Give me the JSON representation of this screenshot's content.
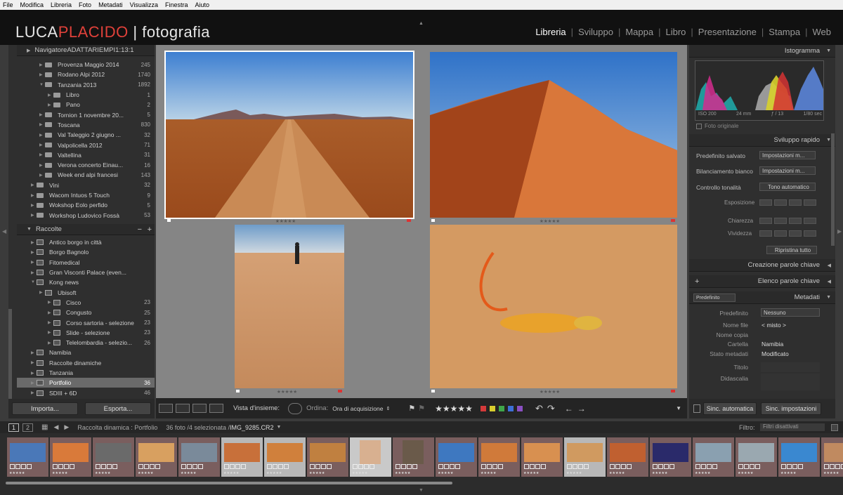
{
  "menu": [
    "File",
    "Modifica",
    "Libreria",
    "Foto",
    "Metadati",
    "Visualizza",
    "Finestra",
    "Aiuto"
  ],
  "logo": {
    "part1": "LUCA",
    "part2": "PLACIDO",
    "part3": " | fotografia"
  },
  "modules": [
    "Libreria",
    "Sviluppo",
    "Mappa",
    "Libro",
    "Presentazione",
    "Stampa",
    "Web"
  ],
  "navigator": {
    "title": "Navigatore",
    "options": [
      "ADATTA",
      "RIEMPI",
      "1:1",
      "3:1"
    ]
  },
  "folders": [
    {
      "name": "Provenza Maggio 2014",
      "count": "245",
      "level": 1
    },
    {
      "name": "Rodano Alpi 2012",
      "count": "1740",
      "level": 1
    },
    {
      "name": "Tanzania 2013",
      "count": "1892",
      "level": 1,
      "open": true
    },
    {
      "name": "Libro",
      "count": "1",
      "level": 2
    },
    {
      "name": "Pano",
      "count": "2",
      "level": 2
    },
    {
      "name": "Tornion 1 novembre 20...",
      "count": "5",
      "level": 1
    },
    {
      "name": "Toscana",
      "count": "830",
      "level": 1
    },
    {
      "name": "Val Taleggio 2 giugno ...",
      "count": "32",
      "level": 1
    },
    {
      "name": "Valpolicella 2012",
      "count": "71",
      "level": 1
    },
    {
      "name": "Valtellina",
      "count": "31",
      "level": 1
    },
    {
      "name": "Verona concerto Einau...",
      "count": "16",
      "level": 1
    },
    {
      "name": "Week end alpi francesi",
      "count": "143",
      "level": 1
    },
    {
      "name": "Vini",
      "count": "32",
      "level": 0
    },
    {
      "name": "Wacom Intuos 5 Touch",
      "count": "9",
      "level": 0
    },
    {
      "name": "Wokshop Eolo perfido",
      "count": "5",
      "level": 0
    },
    {
      "name": "Workshop Ludovico Fossà",
      "count": "53",
      "level": 0
    }
  ],
  "collections": {
    "title": "Raccolte",
    "items": [
      {
        "name": "Antico borgo in città",
        "count": "",
        "level": 0
      },
      {
        "name": "Borgo Bagnolo",
        "count": "",
        "level": 0
      },
      {
        "name": "Fitomedical",
        "count": "",
        "level": 0
      },
      {
        "name": "Gran Visconti Palace (even...",
        "count": "",
        "level": 0
      },
      {
        "name": "Kong news",
        "count": "",
        "level": 0,
        "open": true
      },
      {
        "name": "Ubisoft",
        "count": "",
        "level": 1
      },
      {
        "name": "Cisco",
        "count": "23",
        "level": 2
      },
      {
        "name": "Congusto",
        "count": "25",
        "level": 2
      },
      {
        "name": "Corso sartoria - selezione",
        "count": "23",
        "level": 2
      },
      {
        "name": "Slide - selezione",
        "count": "23",
        "level": 2
      },
      {
        "name": "Telelombardia - selezio...",
        "count": "26",
        "level": 2
      },
      {
        "name": "Namibia",
        "count": "",
        "level": 0
      },
      {
        "name": "Raccolte dinamiche",
        "count": "",
        "level": 0
      },
      {
        "name": "Tanzania",
        "count": "",
        "level": 0
      },
      {
        "name": "Portfolio",
        "count": "36",
        "level": 0,
        "selected": true
      },
      {
        "name": "SDIII + 6D",
        "count": "46",
        "level": 0
      }
    ]
  },
  "import_label": "Importa...",
  "export_label": "Esporta...",
  "stars_label": "★★★★★",
  "toolbar": {
    "overview": "Vista d'insieme:",
    "sort_label": "Ordina:",
    "sort_value": "Ora di acquisizione",
    "rating": "★★★★★",
    "color_labels": [
      "#d33a3a",
      "#d8cd2e",
      "#3fa64a",
      "#3d6fd6",
      "#8a4fc2"
    ]
  },
  "histogram": {
    "title": "Istogramma",
    "iso": "ISO 200",
    "focal": "24 mm",
    "aperture": "ƒ / 13",
    "shutter": "1/80 sec",
    "original": "Foto originale"
  },
  "quick": {
    "title": "Sviluppo rapido",
    "preset_label": "Predefinito salvato",
    "preset_value": "Impostazioni m...",
    "wb_label": "Bilanciamento bianco",
    "wb_value": "Impostazioni m...",
    "tone_label": "Controllo tonalità",
    "tone_auto": "Tono automatico",
    "exposure": "Esposizione",
    "clarity": "Chiarezza",
    "vibrance": "Vividezza",
    "reset": "Ripristina tutto"
  },
  "keywords_title": "Creazione parole chiave",
  "keywordlist_title": "Elenco parole chiave",
  "metadata": {
    "title": "Metadati",
    "preset_select": "Predefinito",
    "preset_label": "Predefinito",
    "preset_value": "Nessuno",
    "filename_label": "Nome file",
    "filename_value": "< misto >",
    "copyname_label": "Nome copia",
    "folder_label": "Cartella",
    "folder_value": "Namibia",
    "status_label": "Stato metadati",
    "status_value": "Modificato",
    "title_label": "Titolo",
    "caption_label": "Didascalia"
  },
  "sync": {
    "auto": "Sinc. automatica",
    "settings": "Sinc. impostazioni"
  },
  "filmstrip": {
    "page1": "1",
    "page2": "2",
    "source": "Raccolta dinamica : Portfolio",
    "info": "36 foto /4 selezionata /",
    "filename": "IMG_9285.CR2",
    "filter_label": "Filtro:",
    "filter_value": "Filtri disattivati"
  }
}
